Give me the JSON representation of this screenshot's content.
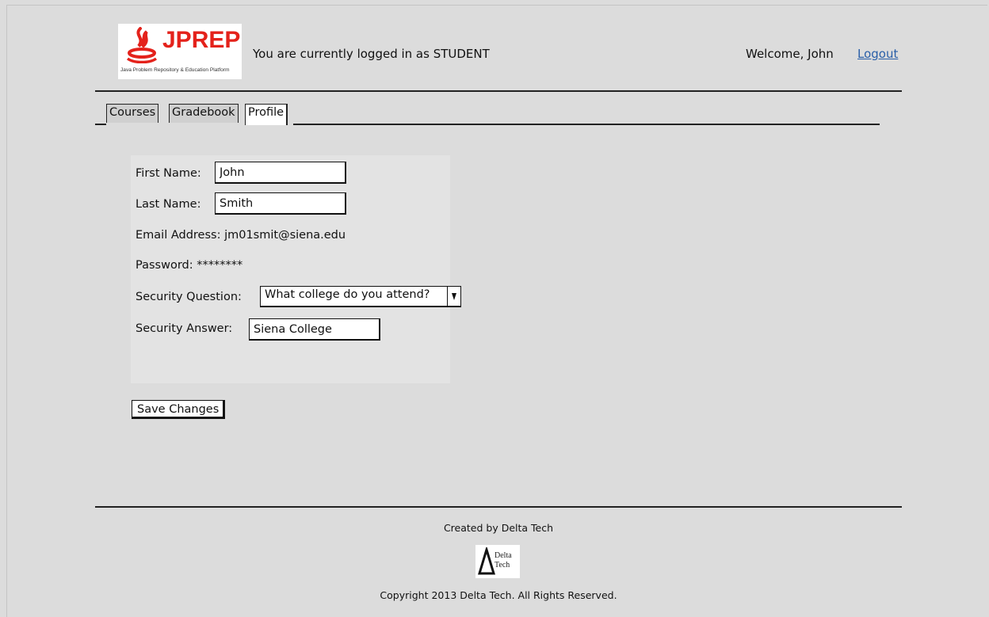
{
  "header": {
    "logo": {
      "name": "JPREP",
      "tagline": "Java Problem Repository & Education Platform"
    },
    "login_status": "You are currently logged in as STUDENT",
    "welcome": "Welcome, John",
    "logout_label": "Logout"
  },
  "tabs": [
    {
      "label": "Courses",
      "active": false
    },
    {
      "label": "Gradebook",
      "active": false
    },
    {
      "label": "Profile",
      "active": true
    }
  ],
  "profile": {
    "first_name_label": "First Name:",
    "first_name_value": "John",
    "last_name_label": "Last Name:",
    "last_name_value": "Smith",
    "email_label": "Email Address:",
    "email_value": "jm01smit@siena.edu",
    "password_label": "Password:",
    "password_value": "********",
    "security_question_label": "Security Question:",
    "security_question_value": "What college do you attend?",
    "security_answer_label": "Security Answer:",
    "security_answer_value": "Siena College"
  },
  "actions": {
    "save_label": "Save Changes"
  },
  "footer": {
    "created_by": "Created by Delta Tech",
    "logo_text_line1": "Delta",
    "logo_text_line2": "Tech",
    "copyright": "Copyright 2013 Delta Tech. All Rights Reserved."
  },
  "colors": {
    "background": "#dcdcdc",
    "panel": "#e3e3e3",
    "brand_red": "#e4221b",
    "link_blue": "#2a5fa8"
  },
  "icons": {
    "logo_mark": "java-cup-flame-icon",
    "dropdown": "dropdown-arrow-icon",
    "footer_mark": "delta-triangle-icon"
  }
}
